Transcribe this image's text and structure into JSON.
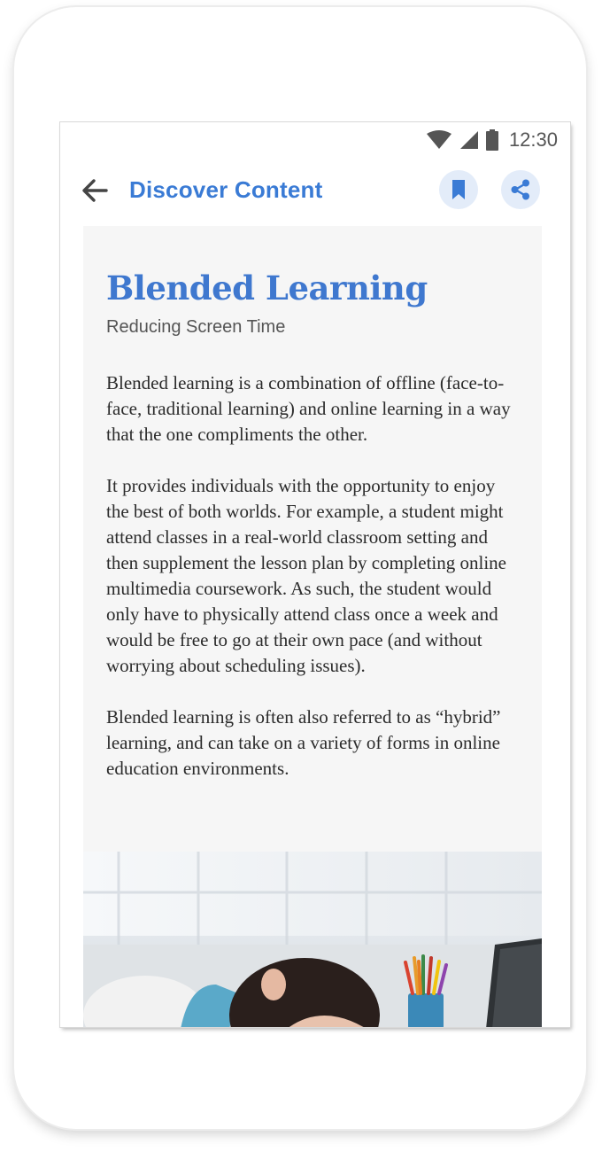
{
  "status_bar": {
    "time": "12:30"
  },
  "app_bar": {
    "title": "Discover Content"
  },
  "article": {
    "title": "Blended Learning",
    "subtitle": "Reducing Screen Time",
    "paragraphs": [
      "Blended learning is a combination of offline (face-to-face, traditional learning) and online learning in a way that the one compliments the other.",
      "It provides individuals with the opportunity to enjoy the best of both worlds. For example, a student might attend classes in a real-world classroom setting and then supplement the lesson plan by completing online multimedia coursework. As such, the student would only have to physically attend class once a week and would be free to go at their own pace (and without worrying about scheduling issues).",
      "Blended learning is often also referred to as “hybrid” learning, and can take on a variety of forms in online education environments."
    ]
  },
  "colors": {
    "accent": "#3a7bd5",
    "icon_bg": "#e3ecf9",
    "card_bg": "#f6f6f6"
  },
  "icons": [
    "wifi-icon",
    "cellular-signal-icon",
    "battery-icon",
    "back-arrow-icon",
    "bookmark-icon",
    "share-icon"
  ]
}
